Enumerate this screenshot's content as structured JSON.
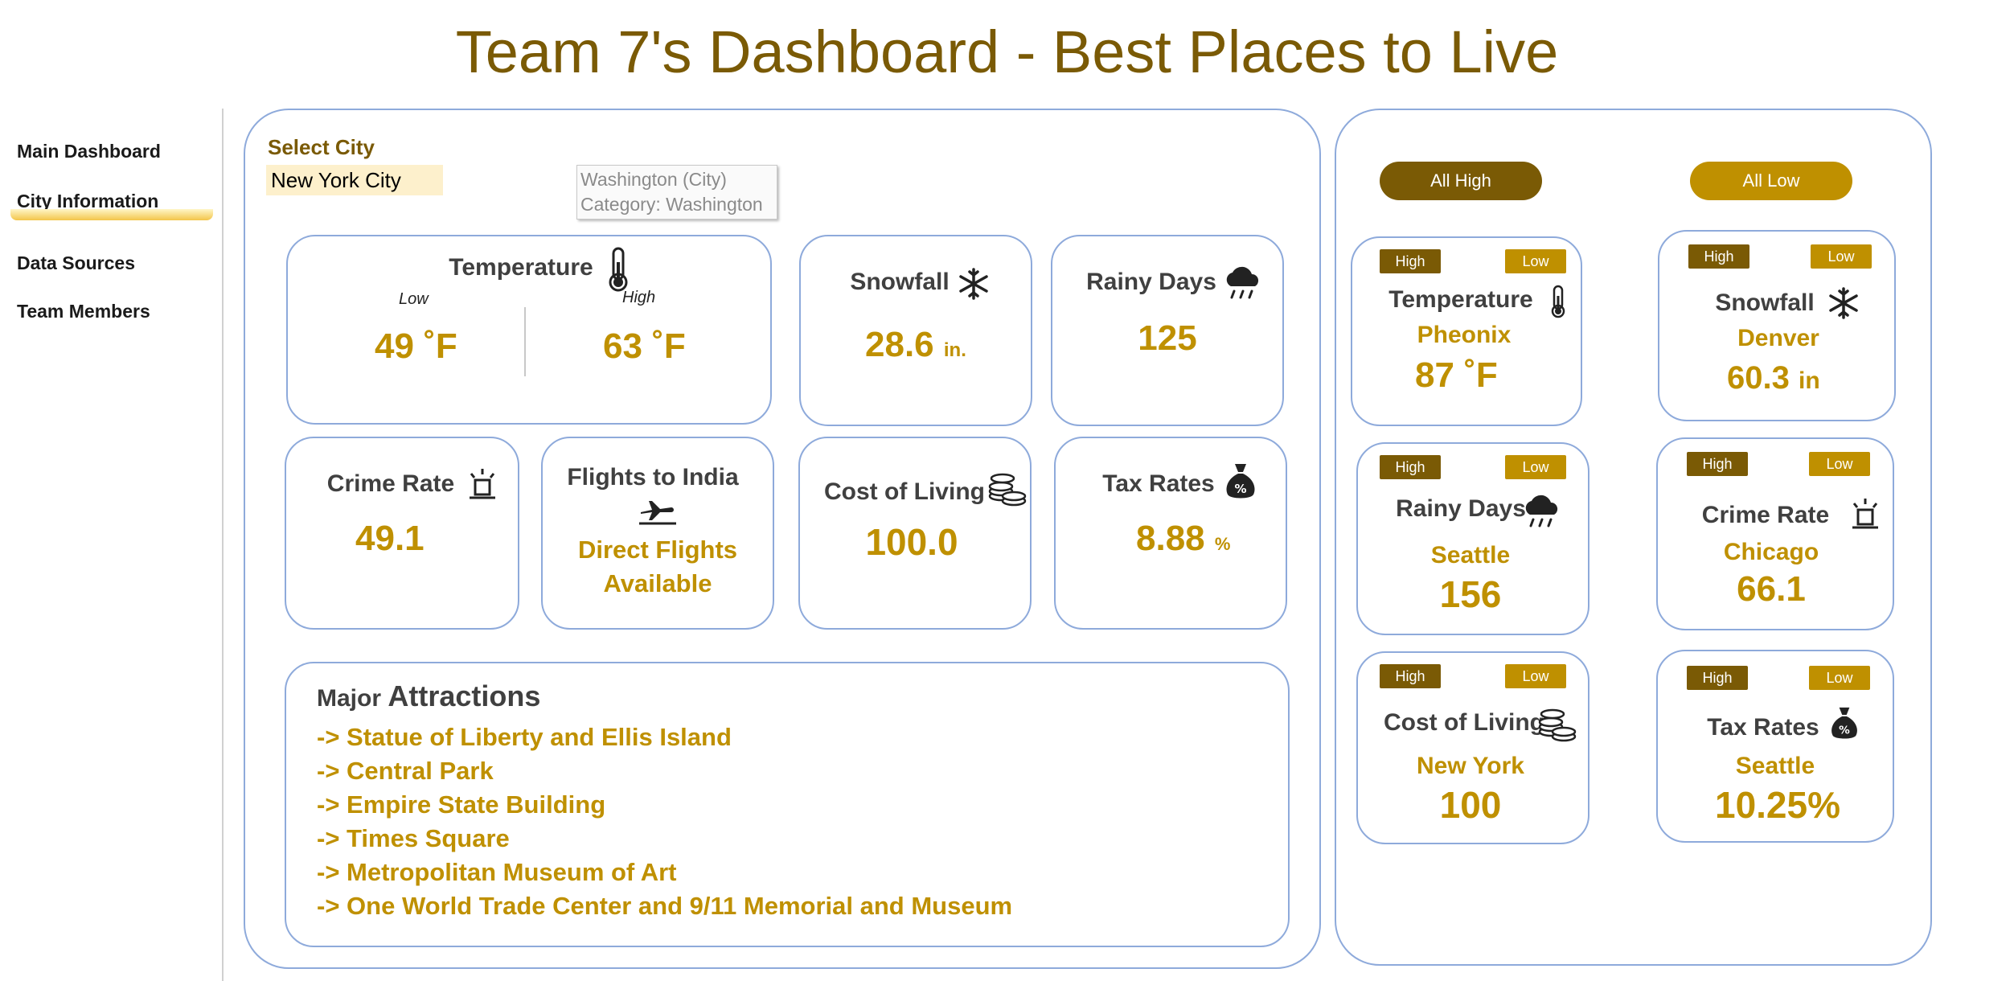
{
  "title": {
    "bold": "Team 7's Dashboard",
    "rest": " - Best Places to Live"
  },
  "sidebar": {
    "items": [
      {
        "label": "Main Dashboard"
      },
      {
        "label": "City Information"
      },
      {
        "label": "Data Sources"
      },
      {
        "label": "Team Members"
      }
    ],
    "active_index": 1
  },
  "city_panel": {
    "select_label": "Select City",
    "selected_city": "New York City",
    "tooltip": {
      "line1": "Washington (City)",
      "line2": "Category: Washington"
    },
    "temperature": {
      "label": "Temperature",
      "low_label": "Low",
      "high_label": "High",
      "low_value": "49",
      "high_value": "63",
      "unit": "˚F"
    },
    "snowfall": {
      "label": "Snowfall",
      "value": "28.6",
      "unit": "in."
    },
    "rainy_days": {
      "label": "Rainy Days",
      "value": "125"
    },
    "crime_rate": {
      "label": "Crime Rate",
      "value": "49.1"
    },
    "flights": {
      "label": "Flights to India",
      "line1": "Direct Flights",
      "line2": "Available"
    },
    "cost_of_living": {
      "label": "Cost of Living",
      "value": "100.0"
    },
    "tax_rates": {
      "label": "Tax Rates",
      "value": "8.88",
      "unit": "%"
    },
    "attractions": {
      "heading_small": "Major ",
      "heading_large": "Attractions",
      "items": [
        "-> Statue of Liberty and Ellis Island",
        "-> Central Park",
        "-> Empire State Building",
        "-> Times Square",
        "-> Metropolitan Museum of Art",
        "-> One World Trade Center and 9/11 Memorial and Museum"
      ]
    }
  },
  "extremes_panel": {
    "all_high_label": "All High",
    "all_low_label": "All Low",
    "high_badge": "High",
    "low_badge": "Low",
    "cards": [
      {
        "label": "Temperature",
        "city": "Pheonix",
        "value": "87",
        "unit": "˚F",
        "icon": "thermometer-icon"
      },
      {
        "label": "Snowfall",
        "city": "Denver",
        "value": "60.3",
        "unit": "in",
        "icon": "snowflake-icon"
      },
      {
        "label": "Rainy Days",
        "city": "Seattle",
        "value": "156",
        "icon": "rain-cloud-icon"
      },
      {
        "label": "Crime Rate",
        "city": "Chicago",
        "value": "66.1",
        "icon": "siren-icon"
      },
      {
        "label": "Cost of Living",
        "city": "New York",
        "value": "100",
        "icon": "coins-icon"
      },
      {
        "label": "Tax Rates",
        "city": "Seattle",
        "value": "10.25%",
        "icon": "money-bag-icon"
      }
    ]
  },
  "colors": {
    "dark_gold": "#7a5a05",
    "gold": "#bf9000",
    "border_blue": "#8eaadb",
    "select_bg": "#fdf0cc"
  }
}
